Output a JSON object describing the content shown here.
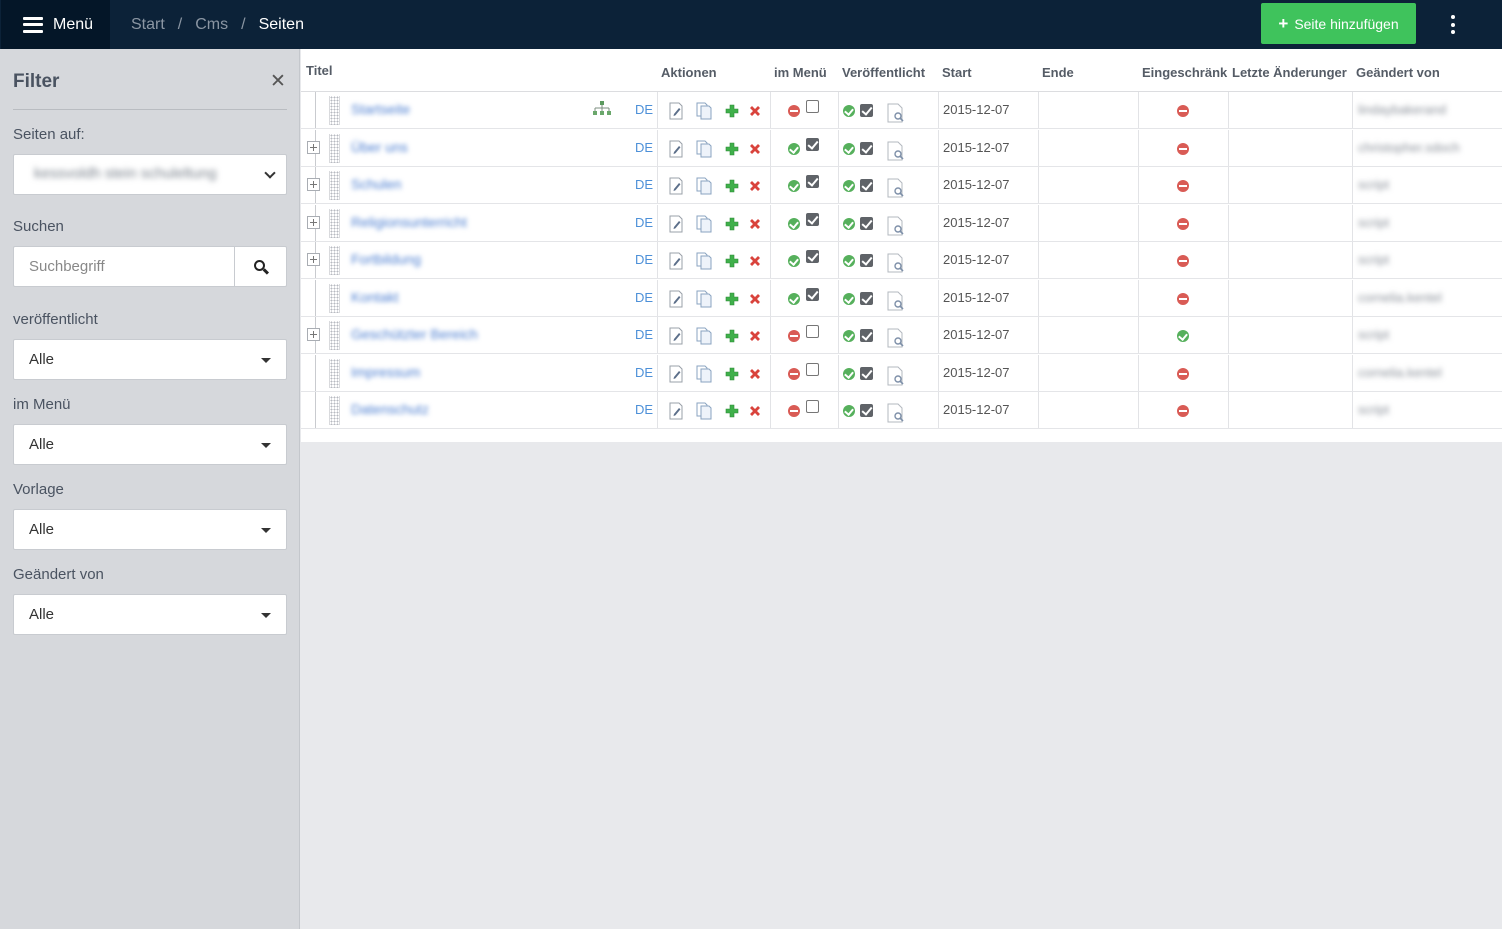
{
  "topbar": {
    "menu_label": "Menü",
    "breadcrumb": [
      "Start",
      "Cms",
      "Seiten"
    ],
    "add_button_label": "Seite hinzufügen",
    "colors": {
      "bar": "#0c2238",
      "menu_bg": "#041628",
      "add_button": "#3fc35c"
    }
  },
  "sidebar": {
    "title": "Filter",
    "close_icon": "close-icon",
    "pages_on_label": "Seiten auf:",
    "pages_on_value": "kessvoldh stein schuleltung",
    "search_label": "Suchen",
    "search_placeholder": "Suchbegriff",
    "search_icon": "search-icon",
    "published_label": "veröffentlicht",
    "published_value": "Alle",
    "in_menu_label": "im Menü",
    "in_menu_value": "Alle",
    "template_label": "Vorlage",
    "template_value": "Alle",
    "changed_by_label": "Geändert von",
    "changed_by_value": "Alle"
  },
  "table": {
    "headers": {
      "title": "Titel",
      "actions": "Aktionen",
      "in_menu": "im Menü",
      "published": "Veröffentlicht",
      "start": "Start",
      "end": "Ende",
      "restricted": "Eingeschränk",
      "last_changes": "Letzte Änderunger",
      "changed_by": "Geändert von"
    },
    "rows": [
      {
        "title": "Startseite",
        "lang": "DE",
        "expandable": false,
        "sitemap": true,
        "in_menu": false,
        "in_menu_checked": false,
        "published": true,
        "published_checked": true,
        "start": "2015-12-07",
        "end": "",
        "restricted": false,
        "changed_by": "lindaybakerand"
      },
      {
        "title": "Über uns",
        "lang": "DE",
        "expandable": true,
        "sitemap": false,
        "in_menu": true,
        "in_menu_checked": true,
        "published": true,
        "published_checked": true,
        "start": "2015-12-07",
        "end": "",
        "restricted": false,
        "changed_by": "christopher.sdoch"
      },
      {
        "title": "Schulen",
        "lang": "DE",
        "expandable": true,
        "sitemap": false,
        "in_menu": true,
        "in_menu_checked": true,
        "published": true,
        "published_checked": true,
        "start": "2015-12-07",
        "end": "",
        "restricted": false,
        "changed_by": "script"
      },
      {
        "title": "Religionsunterricht",
        "lang": "DE",
        "expandable": true,
        "sitemap": false,
        "in_menu": true,
        "in_menu_checked": true,
        "published": true,
        "published_checked": true,
        "start": "2015-12-07",
        "end": "",
        "restricted": false,
        "changed_by": "script"
      },
      {
        "title": "Fortbildung",
        "lang": "DE",
        "expandable": true,
        "sitemap": false,
        "in_menu": true,
        "in_menu_checked": true,
        "published": true,
        "published_checked": true,
        "start": "2015-12-07",
        "end": "",
        "restricted": false,
        "changed_by": "script"
      },
      {
        "title": "Kontakt",
        "lang": "DE",
        "expandable": false,
        "sitemap": false,
        "in_menu": true,
        "in_menu_checked": true,
        "published": true,
        "published_checked": true,
        "start": "2015-12-07",
        "end": "",
        "restricted": false,
        "changed_by": "cornelia.kentel"
      },
      {
        "title": "Geschützter Bereich",
        "lang": "DE",
        "expandable": true,
        "sitemap": false,
        "in_menu": false,
        "in_menu_checked": false,
        "published": true,
        "published_checked": true,
        "start": "2015-12-07",
        "end": "",
        "restricted": true,
        "changed_by": "script"
      },
      {
        "title": "Impressum",
        "lang": "DE",
        "expandable": false,
        "sitemap": false,
        "in_menu": false,
        "in_menu_checked": false,
        "published": true,
        "published_checked": true,
        "start": "2015-12-07",
        "end": "",
        "restricted": false,
        "changed_by": "cornelia.kentel"
      },
      {
        "title": "Datenschutz",
        "lang": "DE",
        "expandable": false,
        "sitemap": false,
        "in_menu": false,
        "in_menu_checked": false,
        "published": true,
        "published_checked": true,
        "start": "2015-12-07",
        "end": "",
        "restricted": false,
        "changed_by": "script"
      }
    ],
    "colors": {
      "link": "#4d7fd1",
      "status_ok": "#56b05c",
      "status_no": "#d95b55",
      "add_icon": "#3fb04a",
      "delete_icon": "#d9433c"
    }
  }
}
